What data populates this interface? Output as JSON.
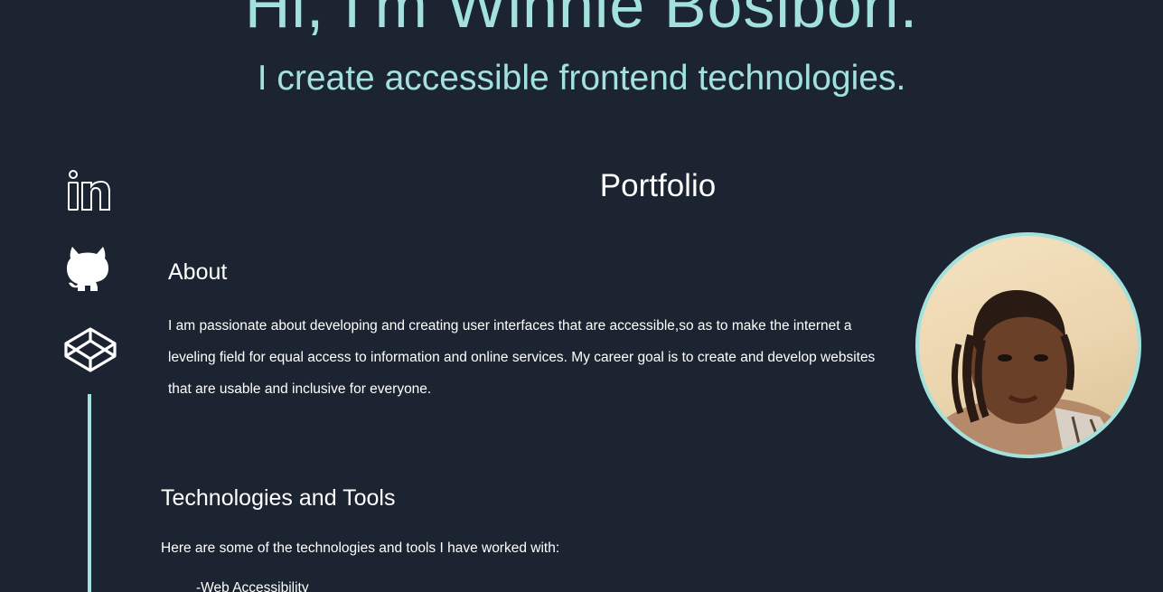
{
  "hero": {
    "title": "Hi, I'm Winnie Bosibori.",
    "subtitle": "I create accessible frontend technologies."
  },
  "social": [
    {
      "name": "linkedin",
      "icon": "linkedin-icon"
    },
    {
      "name": "github",
      "icon": "github-icon"
    },
    {
      "name": "codepen",
      "icon": "codepen-icon"
    }
  ],
  "portfolio": {
    "title": "Portfolio"
  },
  "about": {
    "title": "About",
    "text": "I am passionate about developing and creating user interfaces that are accessible,so as to make the internet a leveling field for equal access to information and online services. My career goal is to create and develop websites that are usable and inclusive for everyone."
  },
  "tech": {
    "title": "Technologies and Tools",
    "intro": "Here are some of the technologies and tools I have worked with:",
    "items": [
      "-Web Accessibility"
    ]
  },
  "colors": {
    "background": "#1b2430",
    "accent": "#a2e1dd",
    "text": "#ffffff"
  }
}
